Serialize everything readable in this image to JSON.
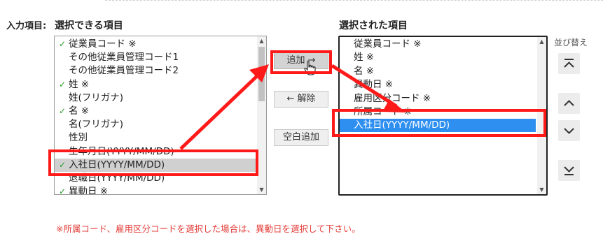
{
  "field_label": "入力項目:",
  "left_heading": "選択できる項目",
  "right_heading": "選択された項目",
  "sort_label": "並び替え",
  "available_items": [
    {
      "label": "従業員コード ※",
      "checked": true,
      "state": ""
    },
    {
      "label": "その他従業員管理コード1",
      "checked": false,
      "state": ""
    },
    {
      "label": "その他従業員管理コード2",
      "checked": false,
      "state": ""
    },
    {
      "label": "姓 ※",
      "checked": true,
      "state": ""
    },
    {
      "label": "姓(フリガナ)",
      "checked": false,
      "state": ""
    },
    {
      "label": "名 ※",
      "checked": true,
      "state": ""
    },
    {
      "label": "名(フリガナ)",
      "checked": false,
      "state": ""
    },
    {
      "label": "性別",
      "checked": false,
      "state": ""
    },
    {
      "label": "生年月日(YYYY/MM/DD)",
      "checked": false,
      "state": ""
    },
    {
      "label": "入社日(YYYY/MM/DD)",
      "checked": true,
      "state": "highlighted"
    },
    {
      "label": "退職日(YYYY/MM/DD)",
      "checked": false,
      "state": ""
    },
    {
      "label": "異動日 ※",
      "checked": true,
      "state": ""
    }
  ],
  "selected_items": [
    {
      "label": "従業員コード ※",
      "state": ""
    },
    {
      "label": "姓 ※",
      "state": ""
    },
    {
      "label": "名 ※",
      "state": ""
    },
    {
      "label": "異動日 ※",
      "state": ""
    },
    {
      "label": "雇用区分コード ※",
      "state": ""
    },
    {
      "label": "所属コード ※",
      "state": ""
    },
    {
      "label": "入社日(YYYY/MM/DD)",
      "state": "selected"
    }
  ],
  "buttons": {
    "add": "追加 →",
    "remove": "← 解除",
    "add_blank": "空白追加"
  },
  "sort_icons": [
    "move-top-icon",
    "move-up-icon",
    "move-down-icon",
    "move-bottom-icon"
  ],
  "note": "※所属コード、雇用区分コードを選択した場合は、異動日を選択して下さい。",
  "colors": {
    "check": "#2a9b2a",
    "selection": "#2e8ff0",
    "annotation": "#ff1a1a",
    "note": "#e4403c"
  }
}
